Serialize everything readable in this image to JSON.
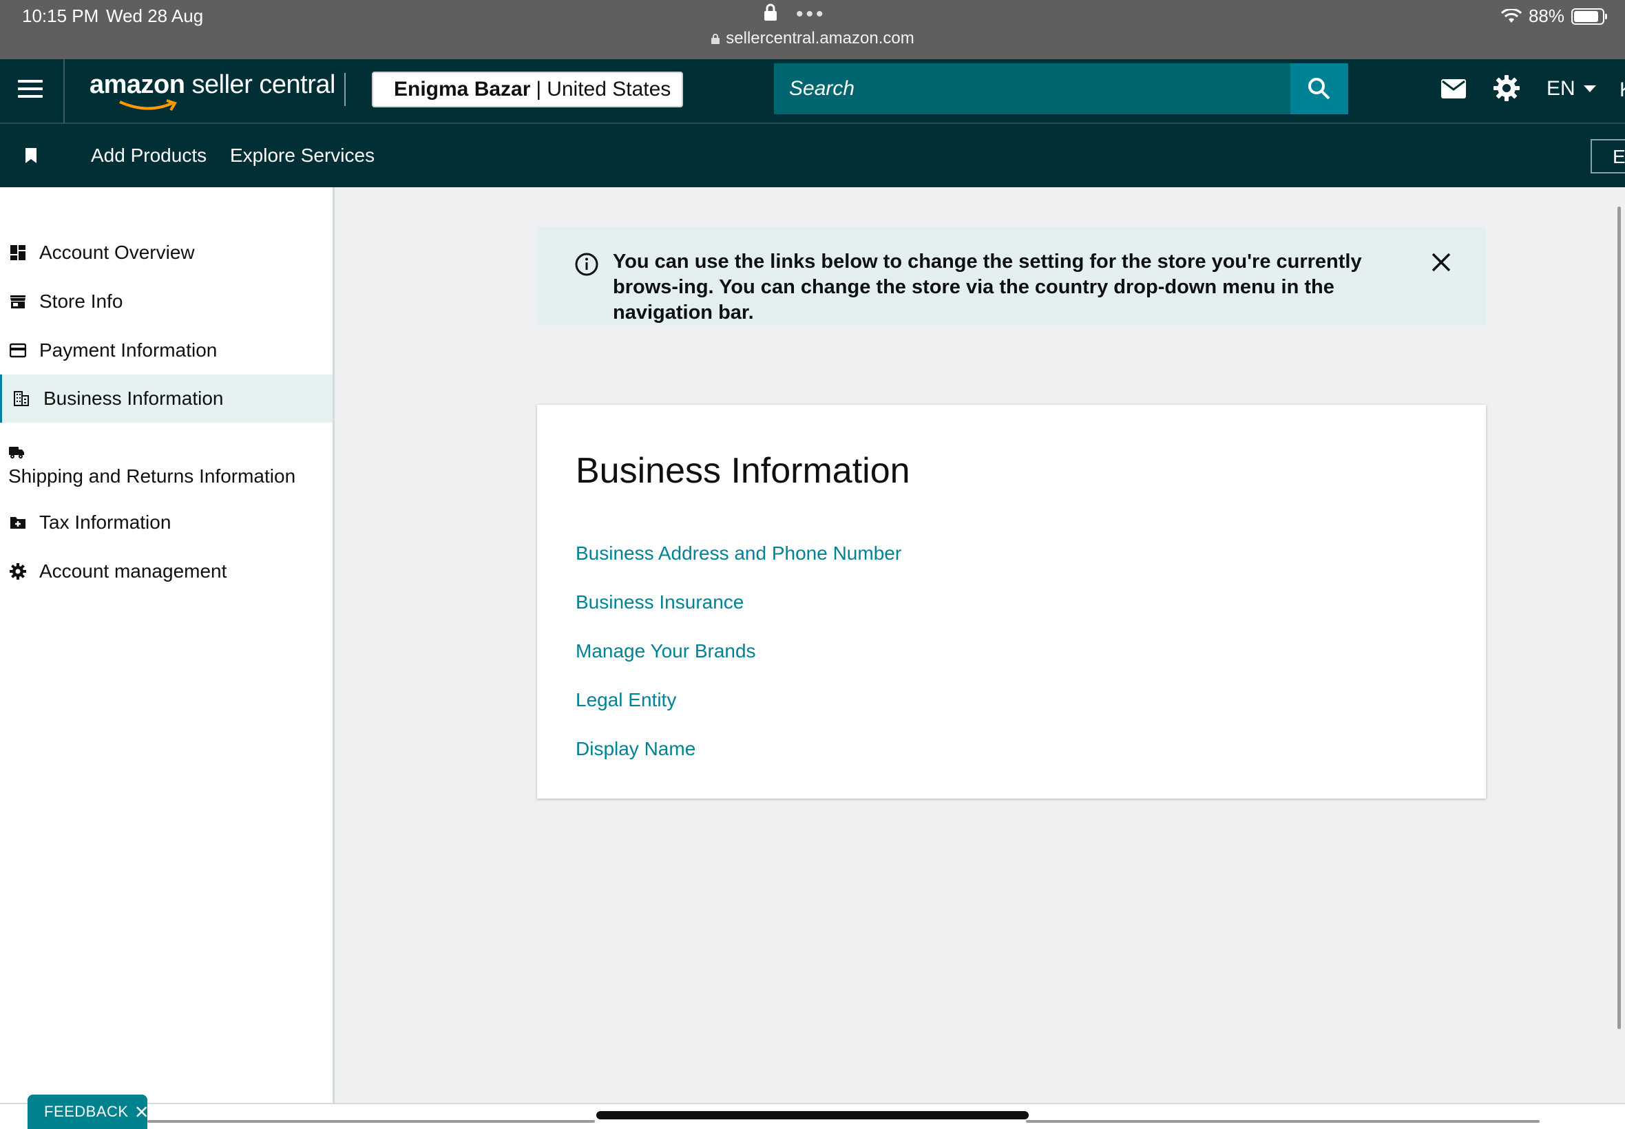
{
  "status_bar": {
    "time": "10:15 PM",
    "date": "Wed 28 Aug",
    "url": "sellercentral.amazon.com",
    "battery": "88%",
    "battery_level": 0.88
  },
  "topnav": {
    "logo_bold": "amazon",
    "logo_rest": " seller central",
    "store_name": "Enigma Bazar",
    "store_separator": "|",
    "store_country": "United States",
    "search_placeholder": "Search",
    "language": "EN",
    "edge_text": "K"
  },
  "subnav": {
    "links": [
      "Add Products",
      "Explore Services"
    ],
    "edge_text": "E"
  },
  "sidebar": {
    "items": [
      {
        "label": "Account Overview",
        "icon": "dashboard-icon"
      },
      {
        "label": "Store Info",
        "icon": "store-icon"
      },
      {
        "label": "Payment Information",
        "icon": "credit-card-icon"
      },
      {
        "label": "Business Information",
        "icon": "building-icon",
        "active": true
      },
      {
        "label": "Shipping and Returns Information",
        "icon": "truck-icon"
      },
      {
        "label": "Tax Information",
        "icon": "tax-folder-icon"
      },
      {
        "label": "Account management",
        "icon": "gear-icon"
      }
    ]
  },
  "alert": {
    "text": "You can use the links below to change the setting for the store you're currently brows-ing. You can change the store via the country drop-down menu in the navigation bar."
  },
  "card": {
    "title": "Business Information",
    "links": [
      "Business Address and Phone Number",
      "Business Insurance",
      "Manage Your Brands",
      "Legal Entity",
      "Display Name"
    ]
  },
  "feedback": {
    "label": "FEEDBACK"
  },
  "colors": {
    "nav_bg": "#002f36",
    "search_bg": "#00656f",
    "accent": "#008296",
    "page_bg": "#eff0f2",
    "alert_bg": "#e3eff1"
  }
}
